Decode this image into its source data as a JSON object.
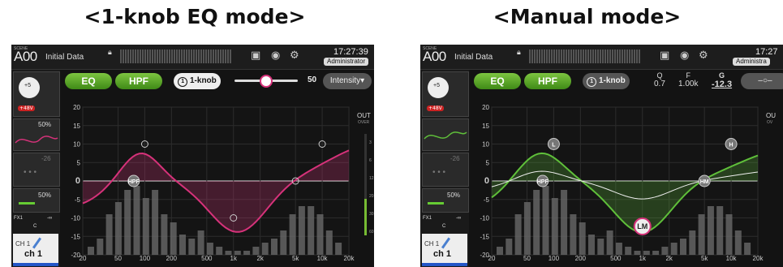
{
  "captions": {
    "left": "<1-knob EQ mode>",
    "right": "<Manual mode>"
  },
  "left_screen": {
    "scene_label": "SCENE",
    "scene_number": "A00",
    "scene_title": "Initial Data",
    "clock": "17:27:39",
    "user": "Administrator",
    "eq_label": "EQ",
    "hpf_label": "HPF",
    "mode_label": "1-knob",
    "mode_number": "1",
    "slider_value": "50",
    "slider_level": 50,
    "intensity_label": "Intensity",
    "gain_knob": "+5",
    "phantom": "+48V",
    "dyn1_value": "50%",
    "dyn_minus": "-26",
    "dyn2_value": "50%",
    "fx_label": "FX1",
    "fx_value": "-∞",
    "pan_label": "C",
    "channel_label": "CH 1",
    "channel_name": "ch 1",
    "out_label": "OUT",
    "over_label": "OVER",
    "y_ticks": [
      "20",
      "15",
      "10",
      "5",
      "0",
      "-5",
      "-10",
      "-15",
      "-20"
    ],
    "x_ticks": [
      "20",
      "50",
      "100",
      "200",
      "500",
      "1k",
      "2k",
      "5k",
      "10k",
      "20k"
    ],
    "meter_ticks": [
      "3",
      "6",
      "12",
      "20",
      "30",
      "60"
    ],
    "band_labels": [
      "HPF"
    ]
  },
  "right_screen": {
    "scene_label": "SCENE",
    "scene_number": "A00",
    "scene_title": "Initial Data",
    "clock": "17:27",
    "user": "Administra",
    "eq_label": "EQ",
    "hpf_label": "HPF",
    "mode_label": "1-knob",
    "mode_number": "1",
    "q_label": "Q",
    "q_value": "0.7",
    "f_label": "F",
    "f_value": "1.00k",
    "g_label": "G",
    "g_value": "-12.3",
    "gain_knob": "+5",
    "phantom": "+48V",
    "dyn_minus": "-26",
    "dyn2_value": "50%",
    "fx_label": "FX1",
    "fx_value": "-∞",
    "pan_label": "C",
    "channel_label": "CH 1",
    "channel_name": "ch 1",
    "out_label": "OU",
    "over_label": "OV",
    "y_ticks": [
      "20",
      "15",
      "10",
      "5",
      "0",
      "-5",
      "-10",
      "-15",
      "-20"
    ],
    "x_ticks": [
      "20",
      "50",
      "100",
      "200",
      "500",
      "1k",
      "2k",
      "5k",
      "10k",
      "20k"
    ],
    "band_labels": [
      "L",
      "H",
      "HPF",
      "HM",
      "LM"
    ]
  },
  "colors": {
    "one_knob_curve": "#d6327a",
    "manual_curve": "#5fbf3a",
    "green_button": "#4a9e22",
    "admin_badge": "#dddddd"
  }
}
